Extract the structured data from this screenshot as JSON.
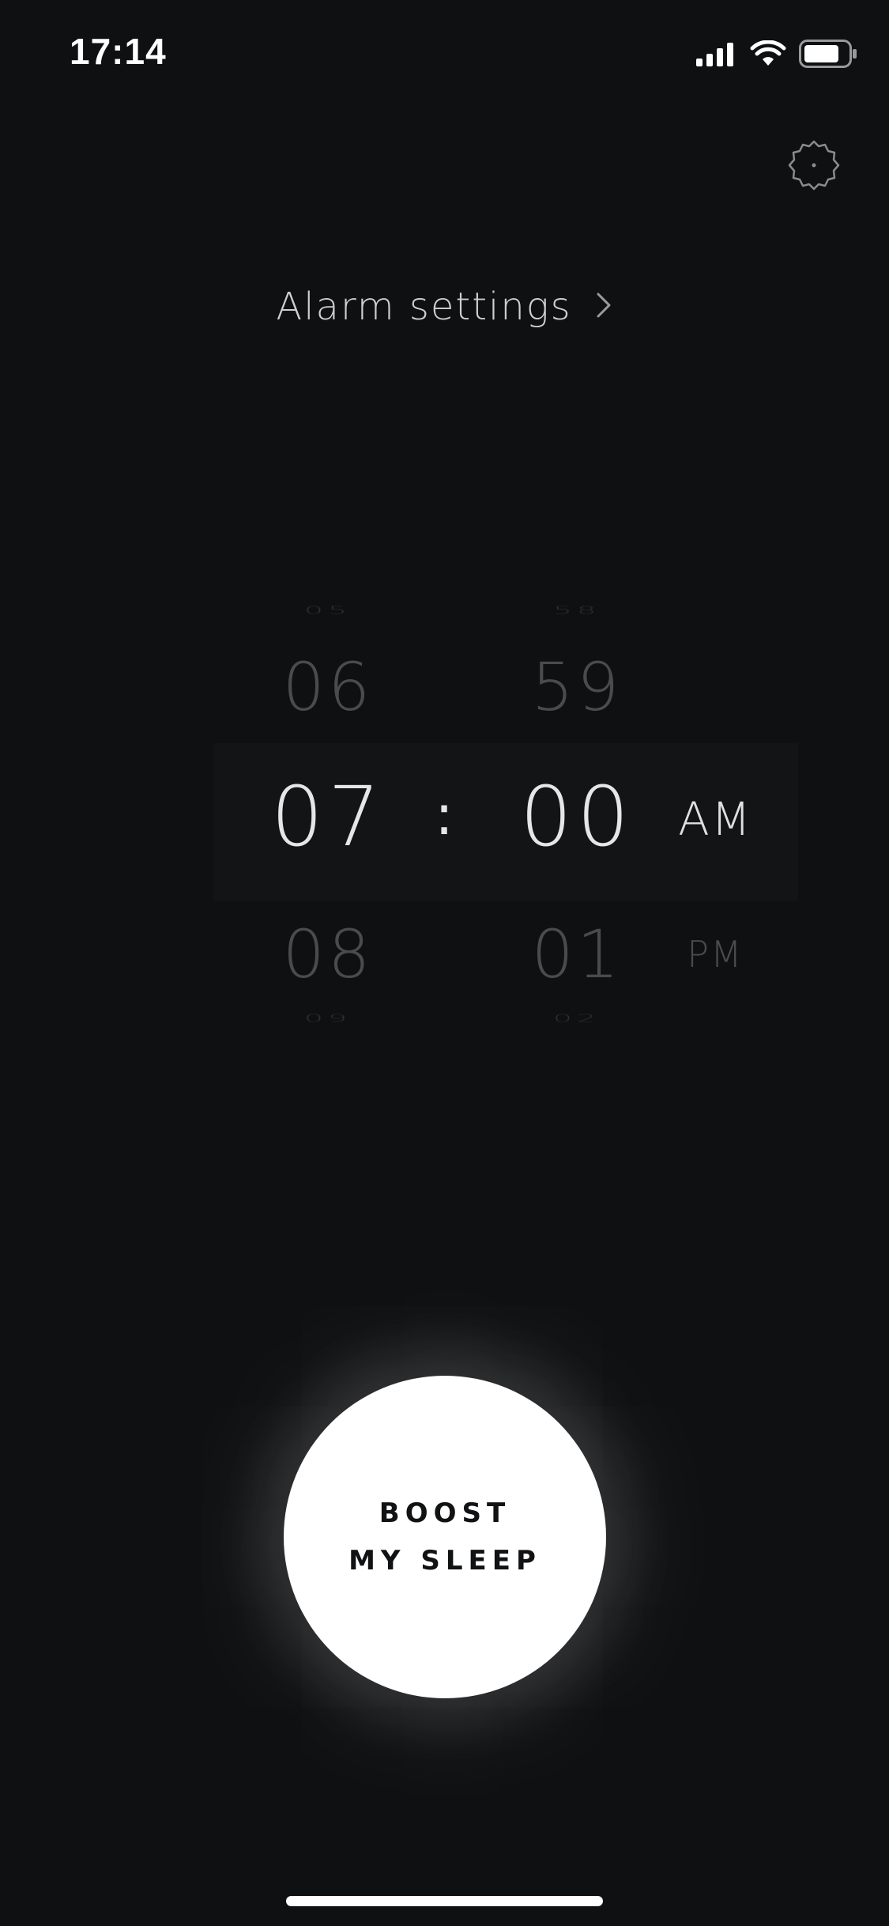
{
  "status_bar": {
    "time": "17:14",
    "icons": [
      "cellular-signal-icon",
      "wifi-icon",
      "battery-icon"
    ]
  },
  "header": {
    "settings_icon": "gear-icon"
  },
  "alarm_settings": {
    "label": "Alarm settings",
    "chevron_icon": "chevron-right-icon"
  },
  "picker": {
    "hour": {
      "far_above": "05",
      "above": "06",
      "selected": "07",
      "below": "08",
      "far_below": "09"
    },
    "separator": ":",
    "minute": {
      "far_above": "58",
      "above": "59",
      "selected": "00",
      "below": "01",
      "far_below": "02"
    },
    "period": {
      "selected": "AM",
      "other": "PM"
    }
  },
  "boost_button": {
    "line1": "BOOST",
    "line2": "MY SLEEP"
  },
  "colors": {
    "background": "#0f1012",
    "selected_text": "#e6e6e6",
    "dim_text": "#4a4b4d",
    "button": "#ffffff"
  }
}
